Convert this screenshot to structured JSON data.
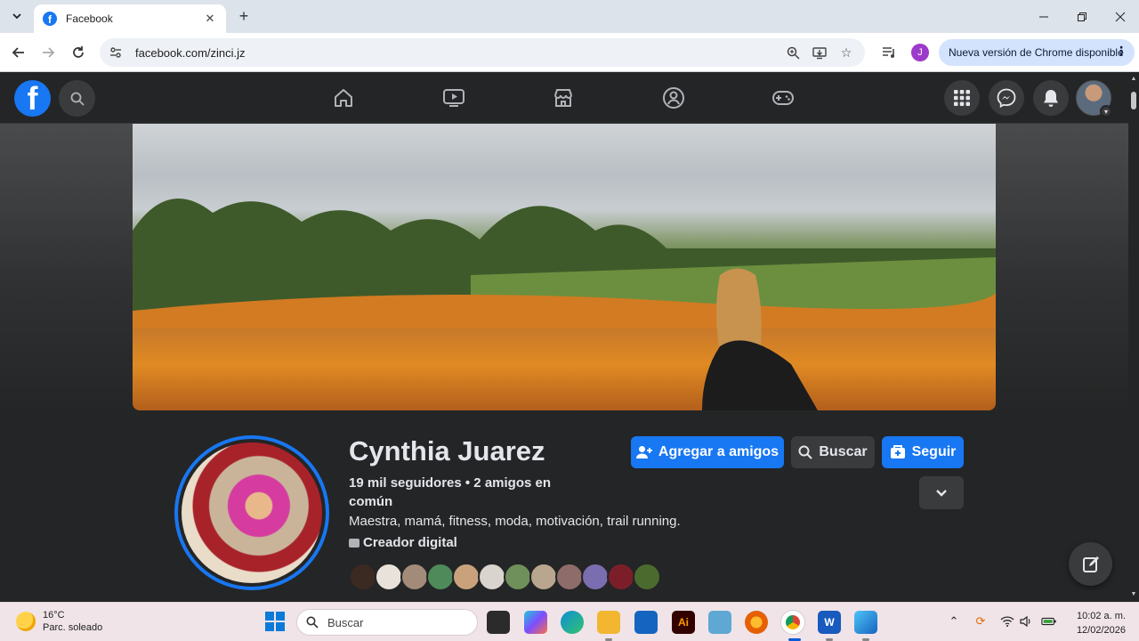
{
  "browser": {
    "tab_title": "Facebook",
    "url": "facebook.com/zinci.jz",
    "profile_initial": "J",
    "update_label": "Nueva versión de Chrome disponible"
  },
  "facebook": {
    "header_icons": [
      "home-icon",
      "watch-icon",
      "marketplace-icon",
      "groups-icon",
      "gaming-icon",
      "menu-grid-icon",
      "messenger-icon",
      "notifications-icon"
    ],
    "profile": {
      "name": "Cynthia Juarez",
      "stats": "19 mil seguidores • 2 amigos en común",
      "bio": "Maestra, mamá, fitness, moda, motivación, trail running.",
      "category": "Creador digital",
      "friend_avatar_count": 12
    },
    "actions": {
      "add_friend": "Agregar a amigos",
      "search": "Buscar",
      "follow": "Seguir"
    },
    "colors": {
      "accent": "#1877f2",
      "surface": "#242526",
      "button_gray": "#3a3b3c"
    }
  },
  "taskbar": {
    "weather_temp": "16°C",
    "weather_desc": "Parc. soleado",
    "search_placeholder": "Buscar",
    "time": "10:02 a. m.",
    "date": "12/02/2026"
  }
}
